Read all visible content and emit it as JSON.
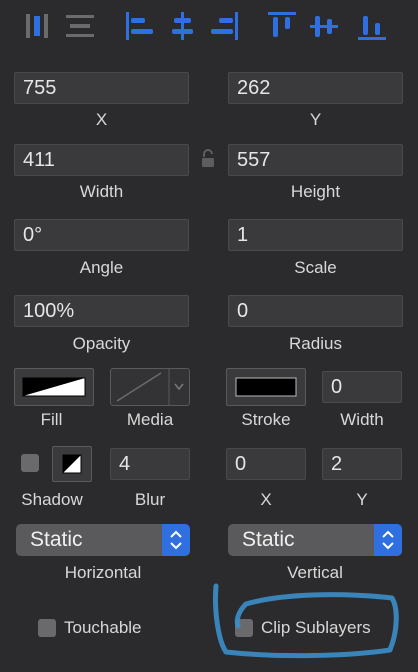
{
  "toolbar": {
    "icons": [
      "distribute-horizontal-icon",
      "distribute-vertical-icon",
      "align-left-icon",
      "align-center-horizontal-icon",
      "align-right-icon",
      "align-top-icon",
      "align-center-vertical-icon",
      "align-bottom-icon"
    ]
  },
  "position": {
    "x_value": "755",
    "x_label": "X",
    "y_value": "262",
    "y_label": "Y"
  },
  "size": {
    "width_value": "411",
    "width_label": "Width",
    "height_value": "557",
    "height_label": "Height"
  },
  "transform": {
    "angle_value": "0°",
    "angle_label": "Angle",
    "scale_value": "1",
    "scale_label": "Scale"
  },
  "appearance": {
    "opacity_value": "100%",
    "opacity_label": "Opacity",
    "radius_value": "0",
    "radius_label": "Radius"
  },
  "fill_row": {
    "fill_label": "Fill",
    "media_label": "Media",
    "stroke_label": "Stroke",
    "stroke_width_value": "0",
    "width_label": "Width"
  },
  "shadow_row": {
    "shadow_label": "Shadow",
    "blur_value": "4",
    "blur_label": "Blur",
    "x_value": "0",
    "x_label": "X",
    "y_value": "2",
    "y_label": "Y"
  },
  "resizing": {
    "horizontal_value": "Static",
    "horizontal_label": "Horizontal",
    "vertical_value": "Static",
    "vertical_label": "Vertical"
  },
  "options": {
    "touchable_label": "Touchable",
    "clip_sublayers_label": "Clip Sublayers"
  },
  "colors": {
    "accent": "#2f6fe0",
    "annotation": "#3b8ec9",
    "background": "#2b2b2d"
  }
}
